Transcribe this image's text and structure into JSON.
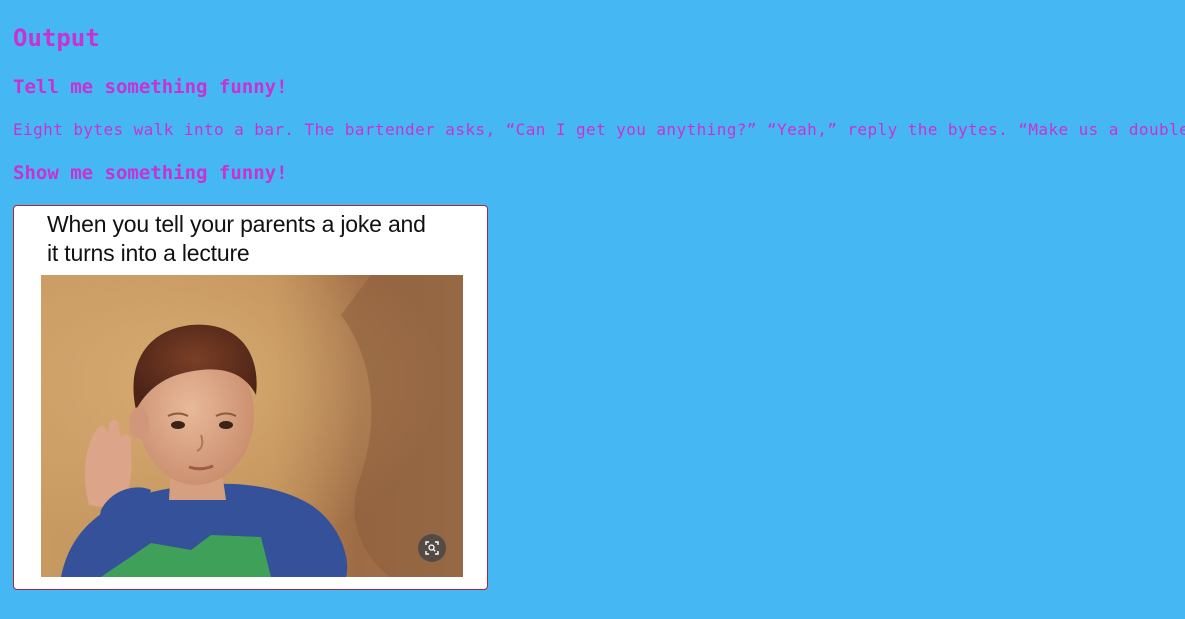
{
  "output": {
    "heading": "Output"
  },
  "conversation": [
    {
      "prompt": "Tell me something funny!",
      "response": "Eight bytes walk into a bar. The bartender asks, “Can I get you anything?” “Yeah,” reply the bytes. “Make us a double.”"
    },
    {
      "prompt": "Show me something funny!",
      "meme": {
        "caption_line1": "When you tell your parents a joke and",
        "caption_line2": "it turns into a lecture",
        "lens_icon": "visual-search-icon"
      }
    }
  ],
  "colors": {
    "background": "#45b8f4",
    "text": "#c832d2",
    "meme_border": "#b0233b"
  }
}
